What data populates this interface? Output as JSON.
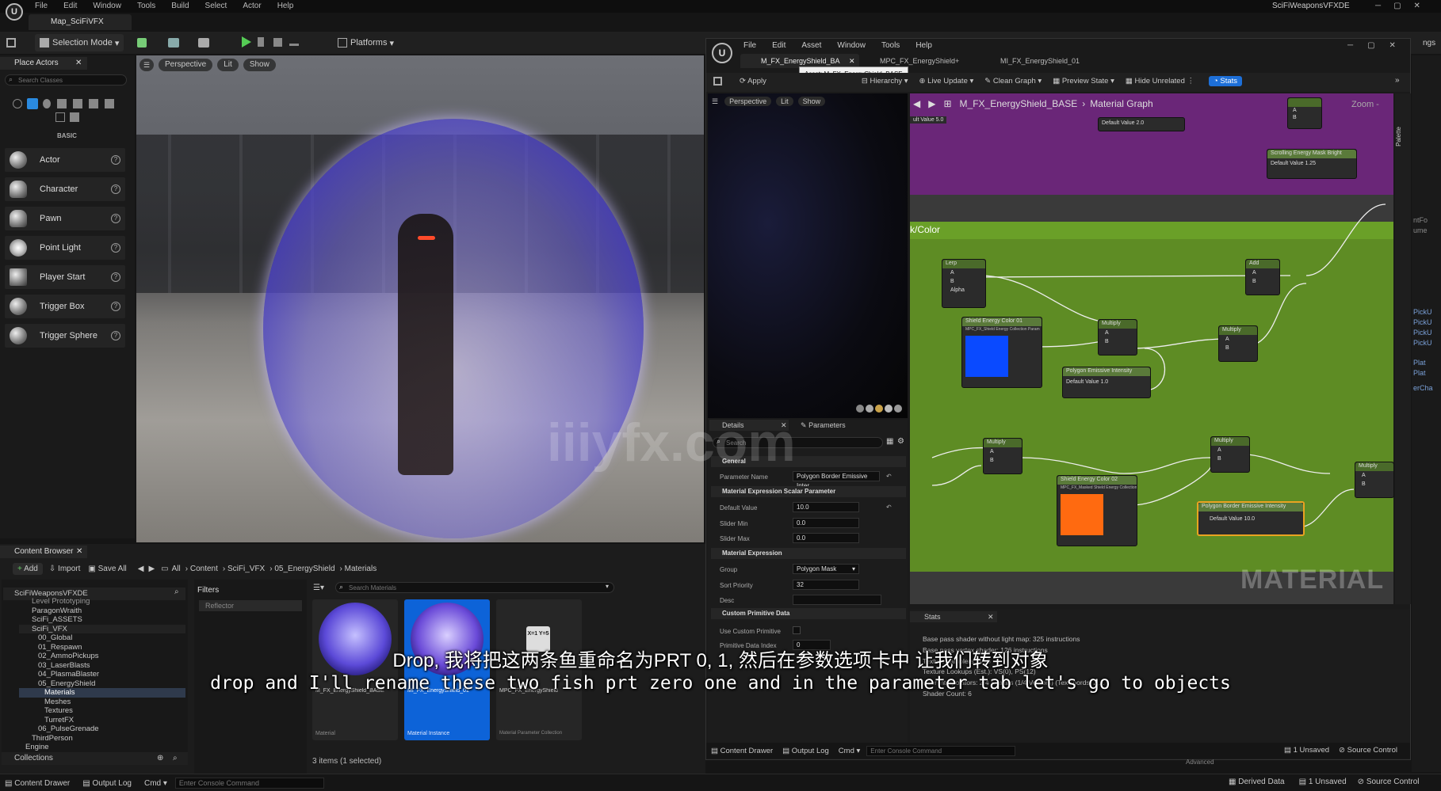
{
  "main_window": {
    "menu": [
      "File",
      "Edit",
      "Window",
      "Tools",
      "Build",
      "Select",
      "Actor",
      "Help"
    ],
    "map_tab": "Map_SciFiVFX",
    "project_name": "SciFiWeaponsVFXDE",
    "selection_mode": "Selection Mode",
    "platforms": "Platforms",
    "right_edge_text": "ngs"
  },
  "place_actors": {
    "title": "Place Actors",
    "search_placeholder": "Search Classes",
    "category": "BASIC",
    "items": [
      "Actor",
      "Character",
      "Pawn",
      "Point Light",
      "Player Start",
      "Trigger Box",
      "Trigger Sphere"
    ]
  },
  "viewport": {
    "perspective": "Perspective",
    "lit": "Lit",
    "show": "Show"
  },
  "content_browser": {
    "title": "Content Browser",
    "add": "Add",
    "import": "Import",
    "save_all": "Save All",
    "breadcrumb": [
      "All",
      "Content",
      "SciFi_VFX",
      "05_EnergyShield",
      "Materials"
    ],
    "filters_label": "Filters",
    "filter_chip": "Reflector",
    "search_placeholder": "Search Materials",
    "tree": [
      "SciFiWeaponsVFXDE",
      "Level Prototyping",
      "ParagonWraith",
      "SciFi_ASSETS",
      "SciFi_VFX",
      "00_Global",
      "01_Respawn",
      "02_AmmoPickups",
      "03_LaserBlasts",
      "04_PlasmaBlaster",
      "05_EnergyShield",
      "Materials",
      "Meshes",
      "Textures",
      "TurretFX",
      "06_PulseGrenade",
      "ThirdPerson",
      "Engine"
    ],
    "collections": "Collections",
    "status": "3 items (1 selected)",
    "assets": [
      {
        "name": "M_FX_EnergyShield_BASE",
        "type": "Material"
      },
      {
        "name": "MI_FX_EnergyShield_01",
        "type": "Material Instance"
      },
      {
        "name": "MPC_FX_EnergyShield",
        "type": "Material Parameter Collection"
      }
    ],
    "mpc_icon_text": "X=1 Y=5"
  },
  "bottom_bar": {
    "content_drawer": "Content Drawer",
    "output_log": "Output Log",
    "cmd": "Cmd",
    "console_placeholder": "Enter Console Command",
    "derived_data": "Derived Data",
    "unsaved": "1 Unsaved",
    "source_control": "Source Control"
  },
  "material_editor": {
    "menu": [
      "File",
      "Edit",
      "Asset",
      "Window",
      "Tools",
      "Help"
    ],
    "tabs": [
      "M_FX_EnergyShield_BA",
      "MPC_FX_EnergyShield+",
      "MI_FX_EnergyShield_01"
    ],
    "tooltip": "Asset: M_FX_EnergyShield_BASE",
    "toolbar": [
      "Apply",
      "Hierarchy",
      "Live Update",
      "Clean Graph",
      "Preview State",
      "Hide Unrelated",
      "Stats"
    ],
    "preview": {
      "perspective": "Perspective",
      "lit": "Lit",
      "show": "Show"
    },
    "graph_breadcrumb": [
      "M_FX_EnergyShield_BASE",
      "Material Graph"
    ],
    "zoom": "Zoom -",
    "comment_label": "k/Color",
    "watermark": "MATERIAL",
    "palette": "Palette",
    "nodes": {
      "lerp": "Lerp",
      "add": "Add",
      "multiply": "Multiply",
      "color1_title": "Shield Energy Color 01",
      "color1_sub": "MPC_FX_Shield Energy Collection Param",
      "color2_title": "Shield Energy Color 02",
      "color2_sub": "MPC_FX_Masked Shield Energy Collection Param",
      "emissive_title": "Polygon Emissive Intensity",
      "emissive_default": "Default Value 1.0",
      "border_title": "Polygon Border Emissive Intensity",
      "border_default": "Default Value 10.0",
      "top_default1": "Default Value 2.0",
      "top_default2": "Default Value 1.25",
      "scrolling": "Scrolling Energy Mask Bright",
      "left_default": "ult Value 5.0",
      "alpha": "Alpha",
      "a": "A",
      "b": "B"
    },
    "details": {
      "tab": "Details",
      "params_tab": "Parameters",
      "search_placeholder": "Search",
      "general": "General",
      "parameter_name_label": "Parameter Name",
      "parameter_name": "Polygon Border Emissive Inter",
      "scalar_section": "Material Expression Scalar Parameter",
      "default_value_label": "Default Value",
      "default_value": "10.0",
      "slider_min_label": "Slider Min",
      "slider_min": "0.0",
      "slider_max_label": "Slider Max",
      "slider_max": "0.0",
      "expr_section": "Material Expression",
      "group_label": "Group",
      "group": "Polygon Mask",
      "sort_label": "Sort Priority",
      "sort": "32",
      "desc_label": "Desc",
      "custom_section": "Custom Primitive Data",
      "use_custom_label": "Use Custom Primitive",
      "prim_index_label": "Primitive Data Index",
      "prim_index": "0"
    },
    "stats": {
      "title": "Stats",
      "lines": [
        "Base pass shader without light map: 325 instructions",
        "Base pass vertex shader: 126 instructions",
        "Texture samplers: 3/16",
        "Texture Lookups (Est.): VS(0), PS(12)",
        "User interpolators: 2/4 Scalars (1/4 Vectors) (TexCoords: 2,...",
        "Shader Count: 6"
      ]
    },
    "bottom": {
      "content_drawer": "Content Drawer",
      "output_log": "Output Log",
      "cmd": "Cmd",
      "console_placeholder": "Enter Console Command",
      "unsaved": "1 Unsaved",
      "source_control": "Source Control",
      "advanced": "Advanced"
    }
  },
  "right_partial": [
    "ntFo",
    "ume",
    "PickU",
    "PickU",
    "PickU",
    "PickU",
    "Plat",
    "Plat",
    "erCha"
  ],
  "subtitles": {
    "chinese": "Drop, 我将把这两条鱼重命名为PRT 0, 1, 然后在参数选项卡中 让我们转到对象",
    "english": "drop and I'll rename these two fish prt zero one and in the parameter tab let's go to objects"
  },
  "site_watermark": "iiiyfx.com"
}
